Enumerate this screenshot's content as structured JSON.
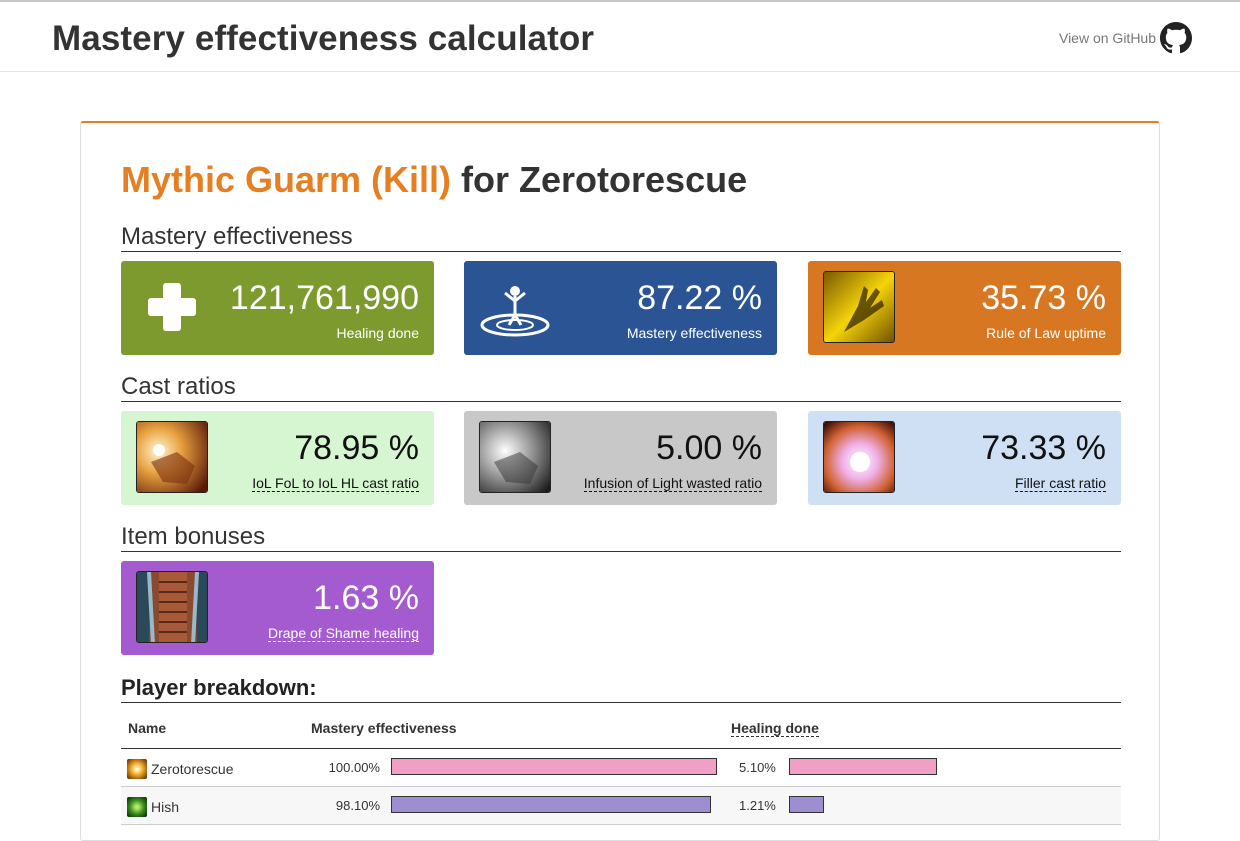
{
  "header": {
    "title": "Mastery effectiveness calculator",
    "github_label": "View on GitHub"
  },
  "report": {
    "fight": "Mythic Guarm (Kill)",
    "for_text": " for Zerotorescue"
  },
  "sections": {
    "mastery": "Mastery effectiveness",
    "cast_ratios": "Cast ratios",
    "item_bonuses": "Item bonuses"
  },
  "tiles": {
    "healing": {
      "value": "121,761,990",
      "label": "Healing done",
      "icon": "plus-icon",
      "color": "#7d9a2e"
    },
    "mastery": {
      "value": "87.22 %",
      "label": "Mastery effectiveness",
      "icon": "mastery-icon",
      "color": "#2a5494"
    },
    "rule_of_law": {
      "value": "35.73 %",
      "label": "Rule of Law uptime",
      "icon": "rule-of-law-icon",
      "color": "#d87722"
    },
    "iol_ratio": {
      "value": "78.95 %",
      "label": "IoL FoL to IoL HL cast ratio",
      "icon": "infusion-of-light-icon",
      "color": "#d5f6d0"
    },
    "iol_wasted": {
      "value": "5.00 %",
      "label": "Infusion of Light wasted ratio",
      "icon": "infusion-of-light-wasted-icon",
      "color": "#c8c8c8"
    },
    "filler": {
      "value": "73.33 %",
      "label": "Filler cast ratio",
      "icon": "holy-light-icon",
      "color": "#cfe0f5"
    },
    "drape": {
      "value": "1.63 %",
      "label": "Drape of Shame healing",
      "icon": "drape-of-shame-icon",
      "color": "#a55bd0"
    }
  },
  "player_breakdown": {
    "title": "Player breakdown:",
    "columns": [
      "Name",
      "Mastery effectiveness",
      "Healing done"
    ],
    "rows": [
      {
        "name": "Zerotorescue",
        "mastery_pct": "100.00%",
        "mastery_value": 100.0,
        "healing_pct": "5.10%",
        "healing_value": 5.1,
        "color": "#f09fc5",
        "icon": "paladin-icon"
      },
      {
        "name": "Hish",
        "mastery_pct": "98.10%",
        "mastery_value": 98.1,
        "healing_pct": "1.21%",
        "healing_value": 1.21,
        "color": "#9c8ed0",
        "icon": "druid-icon"
      }
    ]
  }
}
